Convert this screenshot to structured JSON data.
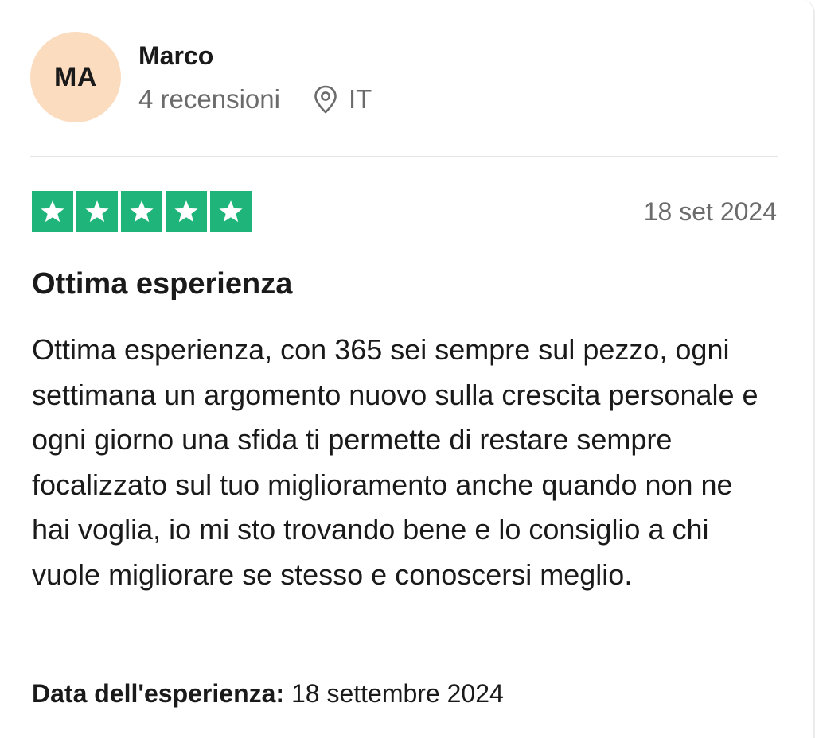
{
  "user": {
    "initials": "MA",
    "name": "Marco",
    "reviews_count": "4 recensioni",
    "country": "IT",
    "avatar_color": "#fcdcbf"
  },
  "review": {
    "rating": 5,
    "max_rating": 5,
    "star_color": "#1fb57a",
    "date": "18 set 2024",
    "title": "Ottima esperienza",
    "body": "Ottima esperienza, con 365 sei sempre sul pezzo, ogni settimana un argomento nuovo sulla crescita personale e ogni giorno una sfida ti permette di restare sempre focalizzato sul tuo miglioramento anche quando non ne hai voglia, io mi sto trovando bene e lo consiglio a chi vuole migliorare se stesso e conoscersi meglio.",
    "experience_label": "Data dell'esperienza:",
    "experience_date": "18 settembre 2024"
  },
  "icons": {
    "location": "location-pin-icon",
    "star": "star-icon"
  }
}
